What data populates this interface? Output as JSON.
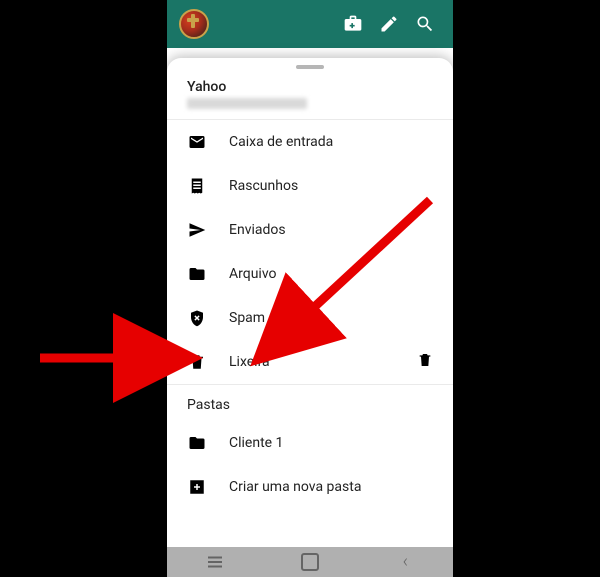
{
  "topbar": {
    "title_partial": "Caixa de entrada"
  },
  "account": {
    "provider": "Yahoo",
    "email_redacted": true
  },
  "folders": [
    {
      "key": "inbox",
      "label": "Caixa de entrada",
      "icon": "mail"
    },
    {
      "key": "drafts",
      "label": "Rascunhos",
      "icon": "receipt"
    },
    {
      "key": "sent",
      "label": "Enviados",
      "icon": "send"
    },
    {
      "key": "archive",
      "label": "Arquivo",
      "icon": "folder"
    },
    {
      "key": "spam",
      "label": "Spam",
      "icon": "shield-x"
    },
    {
      "key": "trash",
      "label": "Lixeira",
      "icon": "trash",
      "action_icon": "trash"
    }
  ],
  "sections": {
    "folders_header": "Pastas"
  },
  "custom_folders": [
    {
      "key": "cliente1",
      "label": "Cliente 1",
      "icon": "folder"
    }
  ],
  "create_folder": {
    "label": "Criar uma nova pasta",
    "icon": "add"
  },
  "colors": {
    "topbar_bg": "#1a7566",
    "arrow": "#e60000"
  }
}
